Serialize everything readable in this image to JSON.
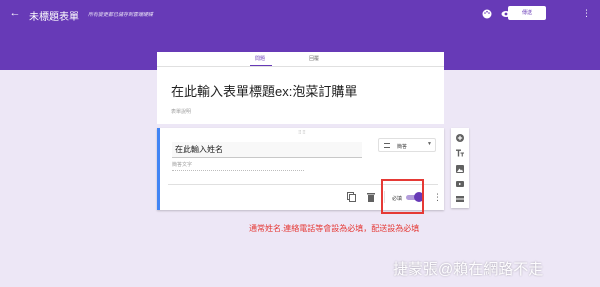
{
  "header": {
    "form_name": "未標題表單",
    "save_status": "所有變更都已儲存到雲端硬碟",
    "send_label": "傳送"
  },
  "tabs": [
    {
      "label": "問題",
      "active": true
    },
    {
      "label": "回覆",
      "active": false
    }
  ],
  "form": {
    "title": "在此輸入表單標題ex:泡菜訂購單",
    "description": "表單說明"
  },
  "question": {
    "title": "在此輸入姓名",
    "answer_placeholder": "簡答文字",
    "type_label": "簡答",
    "required_label": "必填",
    "required": true
  },
  "annotation": "通常姓名.連絡電話等會設為必填，配送設為必填",
  "watermark": "捷蒙張@賴在網路不走",
  "colors": {
    "accent": "#673ab7",
    "annotation": "#e53935"
  }
}
